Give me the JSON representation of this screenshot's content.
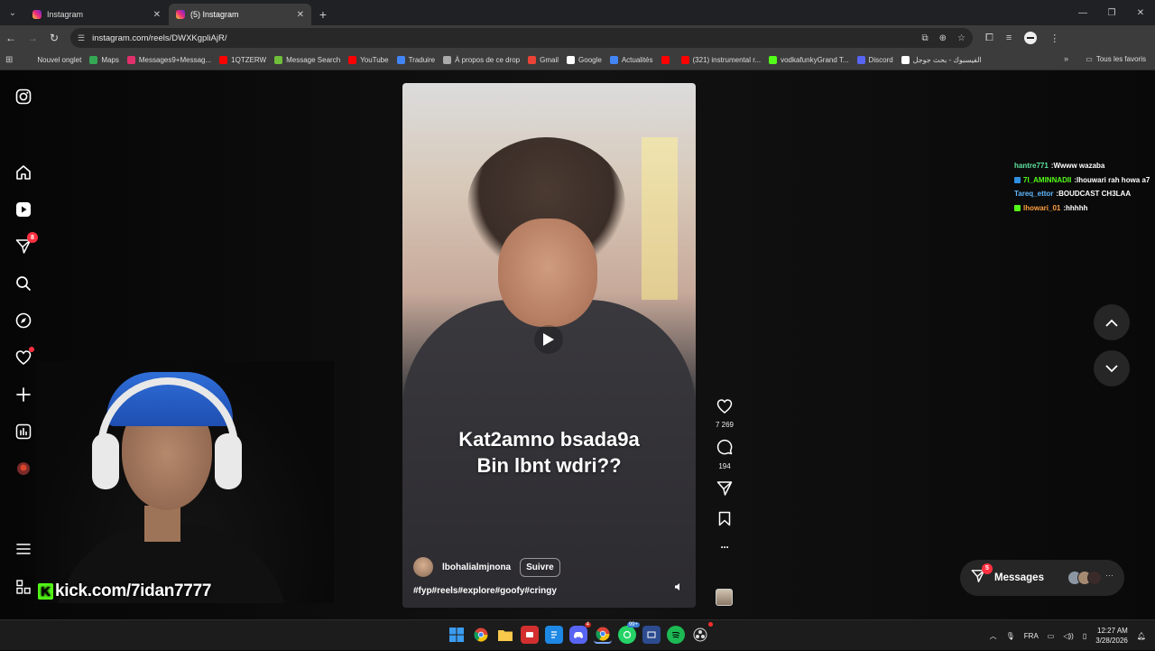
{
  "browser": {
    "tabs": [
      {
        "label": "Instagram",
        "active": false
      },
      {
        "label": "(5) Instagram",
        "active": true
      }
    ],
    "url": "instagram.com/reels/DWXKgpliAjR/",
    "bookmarks": [
      {
        "label": "Nouvel onglet",
        "color": "#3c3c3c"
      },
      {
        "label": "Maps",
        "color": "#34a853"
      },
      {
        "label": "Messages9+Messag...",
        "color": "#e1306c"
      },
      {
        "label": "1QTZERW",
        "color": "#ff0000"
      },
      {
        "label": "Message Search",
        "color": "#6fbf3a"
      },
      {
        "label": "YouTube",
        "color": "#ff0000"
      },
      {
        "label": "Traduire",
        "color": "#4285f4"
      },
      {
        "label": "À propos de ce drop",
        "color": "#aaaaaa"
      },
      {
        "label": "Gmail",
        "color": "#ea4335"
      },
      {
        "label": "Google",
        "color": "#ffffff"
      },
      {
        "label": "Actualités",
        "color": "#4285f4"
      },
      {
        "label": "",
        "color": "#ff0000"
      },
      {
        "label": "(321) instrumental r...",
        "color": "#ff0000"
      },
      {
        "label": "vodkafunkyGrand T...",
        "color": "#53fc18"
      },
      {
        "label": "Discord",
        "color": "#5865f2"
      },
      {
        "label": "الفيسبوك - بحث جوجل",
        "color": "#ffffff"
      }
    ],
    "bookmarks_more": "»",
    "bookmarks_all": "Tous les favoris"
  },
  "sidebar": {
    "direct_badge": "8"
  },
  "reel": {
    "caption_line1": "Kat2amno bsada9a",
    "caption_line2": "Bin lbnt wdri??",
    "username": "lbohalialmjnona",
    "follow_label": "Suivre",
    "hashtags": "#fyp#reels#explore#goofy#cringy",
    "likes": "7 269",
    "comments": "194",
    "more_label": "···"
  },
  "chat": [
    {
      "user": "hantre771",
      "text": "Wwww wazaba",
      "color": "#5fe3a1",
      "badge": ""
    },
    {
      "user": "7I_AMINNADII",
      "text": "lhouwari rah howa a7",
      "color": "#53fc18",
      "badge": "#2f8fe0"
    },
    {
      "user": "Tareq_ettor",
      "text": "BOUDCAST CH3LAA",
      "color": "#5fb8ff",
      "badge": ""
    },
    {
      "user": "lhowari_01",
      "text": "hhhhh",
      "color": "#ff9f40",
      "badge": "#53fc18"
    }
  ],
  "messages": {
    "label": "Messages",
    "badge": "5",
    "more": "···"
  },
  "webcam": {
    "kick_url": "kick.com/7idan7777",
    "kick_letter": "K"
  },
  "taskbar": {
    "lang": "FRA",
    "time": "12:27 AM",
    "date": "3/28/2026",
    "discord_badge": "4",
    "whatsapp_badge": "99+"
  }
}
